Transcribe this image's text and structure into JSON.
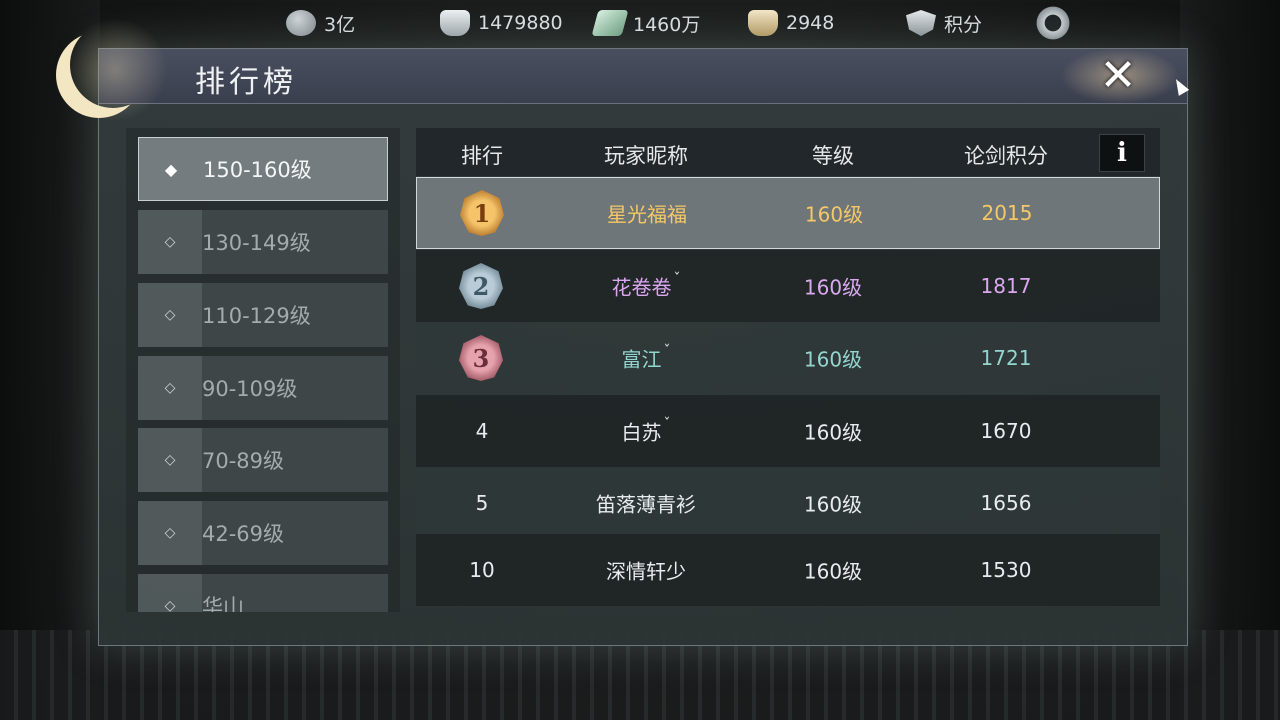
{
  "resources": [
    {
      "icon": "coin-icon",
      "value": "3亿"
    },
    {
      "icon": "silver-ingot-icon",
      "value": "1479880"
    },
    {
      "icon": "jade-icon",
      "value": "1460万"
    },
    {
      "icon": "gold-ingot-icon",
      "value": "2948"
    },
    {
      "icon": "shield-icon",
      "value": "积分"
    }
  ],
  "panel": {
    "title": "排行榜",
    "close_label": "✕"
  },
  "categories": [
    {
      "label": "150-160级",
      "active": true
    },
    {
      "label": "130-149级",
      "active": false
    },
    {
      "label": "110-129级",
      "active": false
    },
    {
      "label": "90-109级",
      "active": false
    },
    {
      "label": "70-89级",
      "active": false
    },
    {
      "label": "42-69级",
      "active": false
    },
    {
      "label": "华山",
      "active": false
    }
  ],
  "table": {
    "headers": {
      "rank": "排行",
      "name": "玩家昵称",
      "level": "等级",
      "score": "论剑积分"
    },
    "info_label": "i",
    "rows": [
      {
        "rank": "1",
        "name": "星光福福",
        "tag": "",
        "level": "160级",
        "score": "2015"
      },
      {
        "rank": "2",
        "name": "花卷卷",
        "tag": "ˇ",
        "level": "160级",
        "score": "1817"
      },
      {
        "rank": "3",
        "name": "富江",
        "tag": "ˇ",
        "level": "160级",
        "score": "1721"
      },
      {
        "rank": "4",
        "name": "白苏",
        "tag": "ˇ",
        "level": "160级",
        "score": "1670"
      },
      {
        "rank": "5",
        "name": "笛落薄青衫",
        "tag": "",
        "level": "160级",
        "score": "1656"
      },
      {
        "rank": "10",
        "name": "深情轩少",
        "tag": "",
        "level": "160级",
        "score": "1530"
      }
    ]
  },
  "colors": {
    "rank1": "#f4c866",
    "rank2": "#d9a8f0",
    "rank3": "#93d6cf",
    "default": "#e9ecee"
  }
}
